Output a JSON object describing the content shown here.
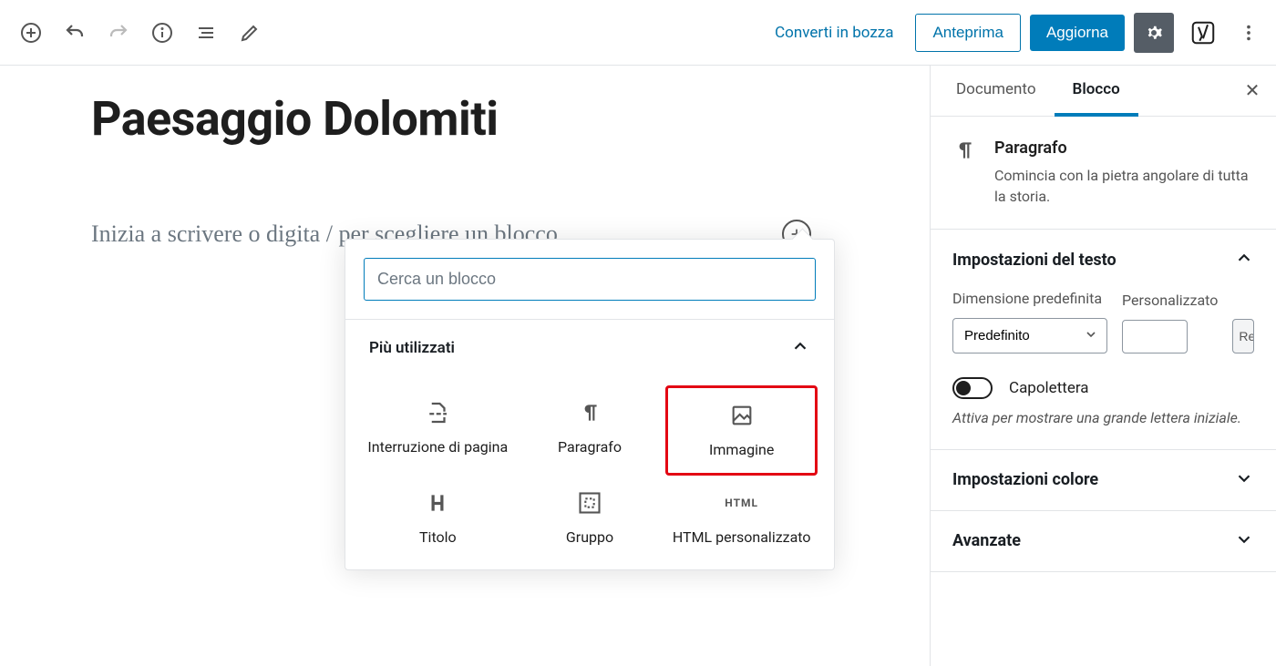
{
  "toolbar": {
    "convert_draft": "Converti in bozza",
    "preview": "Anteprima",
    "update": "Aggiorna"
  },
  "editor": {
    "title": "Paesaggio Dolomiti",
    "placeholder": "Inizia a scrivere o digita / per scegliere un blocco"
  },
  "inserter": {
    "search_placeholder": "Cerca un blocco",
    "section_title": "Più utilizzati",
    "blocks": [
      {
        "label": "Interruzione di pagina"
      },
      {
        "label": "Paragrafo"
      },
      {
        "label": "Immagine"
      },
      {
        "label": "Titolo"
      },
      {
        "label": "Gruppo"
      },
      {
        "label": "HTML personalizzato"
      }
    ]
  },
  "sidebar": {
    "tab_document": "Documento",
    "tab_block": "Blocco",
    "block": {
      "name": "Paragrafo",
      "description": "Comincia con la pietra angolare di tutta la storia."
    },
    "text_settings": {
      "title": "Impostazioni del testo",
      "size_label": "Dimensione predefinita",
      "size_value": "Predefinito",
      "custom_label": "Personalizzato",
      "reset": "Re",
      "dropcap_label": "Capolettera",
      "dropcap_hint": "Attiva per mostrare una grande lettera iniziale."
    },
    "color_panel": "Impostazioni colore",
    "advanced_panel": "Avanzate"
  }
}
